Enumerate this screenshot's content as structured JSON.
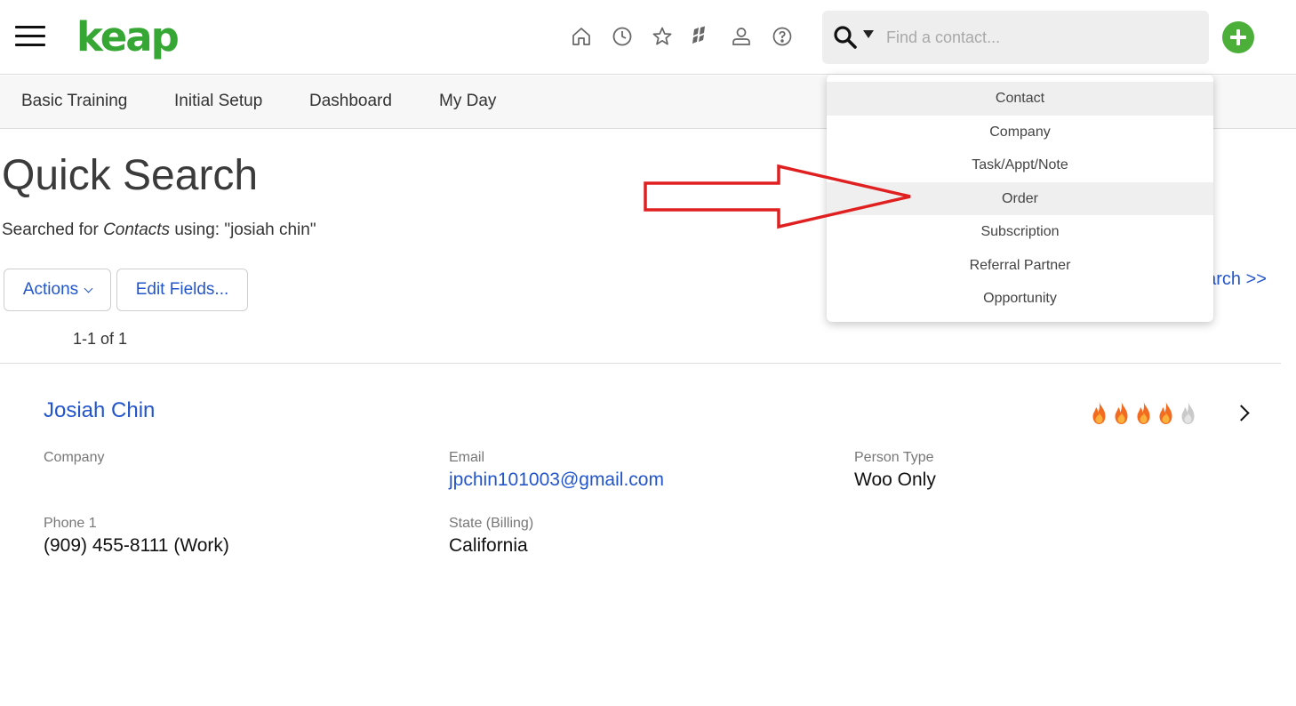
{
  "header": {
    "logo_text": "keap",
    "brand_color": "#36a635",
    "nav_icons": [
      "home-icon",
      "clock-icon",
      "star-icon",
      "feather-icon",
      "person-icon",
      "help-icon"
    ],
    "search": {
      "placeholder": "Find a contact...",
      "value": ""
    },
    "add_button_color": "#4caf3a"
  },
  "tabs": [
    {
      "label": "Basic Training"
    },
    {
      "label": "Initial Setup"
    },
    {
      "label": "Dashboard"
    },
    {
      "label": "My Day"
    }
  ],
  "main": {
    "title": "Quick Search",
    "summary_prefix": "Searched for",
    "summary_entity": "Contacts",
    "summary_suffix": "using: \"josiah chin\"",
    "actions_label": "Actions",
    "edit_fields_label": "Edit Fields...",
    "advanced_link": "earch >>",
    "result_count": "1-1 of 1"
  },
  "result": {
    "name": "Josiah Chin",
    "score_active": 4,
    "score_total": 5,
    "fields": {
      "company_label": "Company",
      "company_value": "",
      "email_label": "Email",
      "email_value": "jpchin101003@gmail.com",
      "person_type_label": "Person Type",
      "person_type_value": "Woo Only",
      "phone_label": "Phone 1",
      "phone_value": "(909) 455-8111 (Work)",
      "state_label": "State (Billing)",
      "state_value": "California"
    }
  },
  "dropdown": {
    "items": [
      {
        "label": "Contact",
        "highlighted": true
      },
      {
        "label": "Company",
        "highlighted": false
      },
      {
        "label": "Task/Appt/Note",
        "highlighted": false
      },
      {
        "label": "Order",
        "highlighted": true
      },
      {
        "label": "Subscription",
        "highlighted": false
      },
      {
        "label": "Referral Partner",
        "highlighted": false
      },
      {
        "label": "Opportunity",
        "highlighted": false
      }
    ]
  },
  "annotation_color": "#e02020"
}
